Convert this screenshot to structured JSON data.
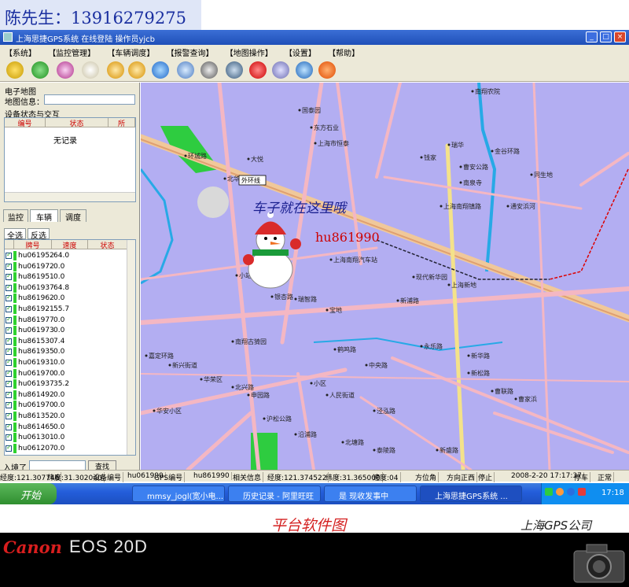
{
  "contact": "陈先生：13916279275",
  "window": {
    "title": "上海思捷GPS系统  在线登陆  操作员yjcb"
  },
  "menu": [
    "【系统】",
    "【监控管理】",
    "【车辆调度】",
    "【报警查询】",
    "【地图操作】",
    "【设置】",
    "【帮助】"
  ],
  "toolbar": {
    "icons": [
      "key-icon",
      "pointer-icon",
      "wand-icon",
      "hand-icon",
      "zoom-in-icon",
      "zoom-out-icon",
      "refresh-icon",
      "ruler-icon",
      "measure-icon",
      "track-icon",
      "phone-icon",
      "user-icon",
      "connect-icon",
      "stop-icon"
    ]
  },
  "left_panel": {
    "map_section": "电子地图",
    "map_name_label": "地图信息：",
    "status_section": "设备状态与交互",
    "status_columns": [
      "编号",
      "状态",
      "所"
    ],
    "no_records": "无记录",
    "tabs": [
      "监控",
      "车辆",
      "调度"
    ],
    "subtabs": [
      "全选",
      "反选"
    ],
    "vehicle_columns": [
      "牌号",
      "速度",
      "状态"
    ],
    "vehicles": [
      {
        "plate": "hu061952",
        "speed": "64.0"
      },
      {
        "plate": "hu061972",
        "speed": "0.0"
      },
      {
        "plate": "hu861951",
        "speed": "0.0"
      },
      {
        "plate": "hu061937",
        "speed": "64.8"
      },
      {
        "plate": "hu861962",
        "speed": "0.0"
      },
      {
        "plate": "hu861921",
        "speed": "55.7"
      },
      {
        "plate": "hu861977",
        "speed": "0.0"
      },
      {
        "plate": "hu061973",
        "speed": "0.0"
      },
      {
        "plate": "hu861530",
        "speed": "7.4"
      },
      {
        "plate": "hu861935",
        "speed": "0.0"
      },
      {
        "plate": "hu061931",
        "speed": "0.0"
      },
      {
        "plate": "hu061970",
        "speed": "0.0"
      },
      {
        "plate": "hu061937",
        "speed": "35.2"
      },
      {
        "plate": "hu861492",
        "speed": "0.0"
      },
      {
        "plate": "hu061970",
        "speed": "0.0"
      },
      {
        "plate": "hu861352",
        "speed": "0.0"
      },
      {
        "plate": "hu861465",
        "speed": "0.0"
      },
      {
        "plate": "hu061301",
        "speed": "0.0"
      },
      {
        "plate": "hu061207",
        "speed": "0.0"
      }
    ],
    "search_label": "入境了",
    "search_button": "查找"
  },
  "map": {
    "car_here": "车子就在这里哦",
    "vehicle_label": "hu861990",
    "road_label": "外环线",
    "place_labels": [
      "南翔农院",
      "国泰园",
      "东方石业",
      "上海市恒泰",
      "瑞华",
      "曹安公路",
      "北华路",
      "环城路",
      "南泉寺",
      "钱家",
      "大悦",
      "通安浜河",
      "金谷环路",
      "同生地",
      "上海南翔镇路",
      "小站",
      "上海南翔汽车站",
      "现代新华园",
      "上海新地",
      "瑞智路",
      "银杏路",
      "宝地",
      "新浦路",
      "南翔古猗园",
      "嘉定环路",
      "新兴街道",
      "华荣区",
      "北兴路",
      "申园路",
      "鹤鸣路",
      "中央路",
      "永乐路",
      "新华路",
      "小区",
      "人民街道",
      "泾泓路",
      "新松路",
      "曹联路",
      "曹家浜",
      "华安小区",
      "沪松公路",
      "沿浦路",
      "北塘路",
      "泰陵路",
      "新盛路"
    ]
  },
  "statusbar": [
    "经度:121.307746",
    "纬度:31.302040",
    "设备编号",
    "hu061990",
    "GPS编号",
    "hu861990",
    "相关信息",
    "经度:121.374522",
    "纬度:31.365000",
    "速度:04",
    "方位角",
    "方向正西",
    "停止",
    "2008-2-20 17:17:37",
    "停车",
    "正常"
  ],
  "taskbar": {
    "start": "开始",
    "items": [
      "mmsy_jogl(宽小电...",
      "历史记录 - 阿里旺旺",
      "是 现收发事中",
      "上海思捷GPS系统 ..."
    ],
    "time": "17:18"
  },
  "captions": {
    "platform": "平台软件图",
    "company": "上海GPS公司",
    "camera_brand": "Canon",
    "camera_model": "EOS 20D"
  },
  "colors": {
    "map_bg": "#b3aef2",
    "road": "#f4b7c3",
    "major_road": "#f0c89a",
    "water": "#27a9e6",
    "green": "#2ecc40",
    "caption_red": "#d42020",
    "vehicle_label": "#cc0000"
  }
}
